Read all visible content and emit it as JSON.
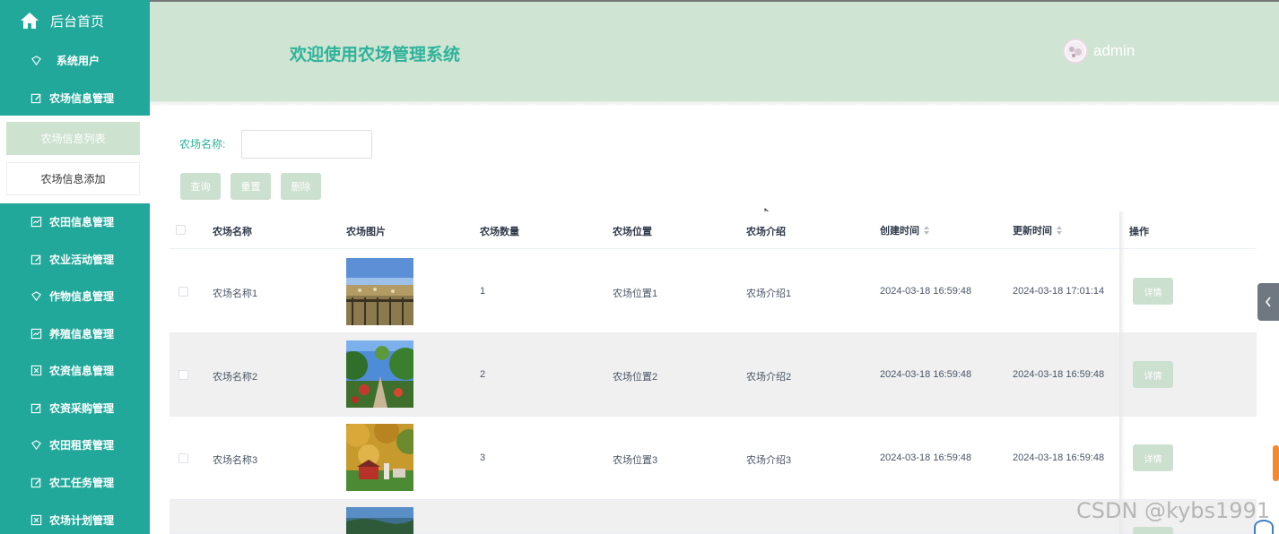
{
  "sidebar": {
    "home_label": "后台首页",
    "items_top": [
      {
        "label": "系统用户",
        "icon": "shield-icon"
      },
      {
        "label": "农场信息管理",
        "icon": "edit-icon"
      }
    ],
    "sub_items": [
      {
        "label": "农场信息列表",
        "active": true
      },
      {
        "label": "农场信息添加",
        "active": false
      }
    ],
    "items_bottom": [
      {
        "label": "农田信息管理",
        "icon": "chart-icon"
      },
      {
        "label": "农业活动管理",
        "icon": "edit-icon"
      },
      {
        "label": "作物信息管理",
        "icon": "shield-icon"
      },
      {
        "label": "养殖信息管理",
        "icon": "chart-icon"
      },
      {
        "label": "农资信息管理",
        "icon": "close-box-icon"
      },
      {
        "label": "农资采购管理",
        "icon": "edit-icon"
      },
      {
        "label": "农田租赁管理",
        "icon": "shield-icon"
      },
      {
        "label": "农工任务管理",
        "icon": "edit-icon"
      },
      {
        "label": "农场计划管理",
        "icon": "close-box-icon"
      }
    ]
  },
  "header": {
    "title": "欢迎使用农场管理系统",
    "username": "admin"
  },
  "search": {
    "label": "农场名称:",
    "value": "",
    "placeholder": ""
  },
  "buttons": {
    "query": "查询",
    "reset": "重置",
    "delete": "删除"
  },
  "table": {
    "columns": [
      "农场名称",
      "农场图片",
      "农场数量",
      "农场位置",
      "农场介绍",
      "创建时间",
      "更新时间",
      "操作"
    ],
    "rows": [
      {
        "name": "农场名称1",
        "quantity": "1",
        "location": "农场位置1",
        "intro": "农场介绍1",
        "created": "2024-03-18 16:59:48",
        "updated": "2024-03-18 17:01:14",
        "action": "详情"
      },
      {
        "name": "农场名称2",
        "quantity": "2",
        "location": "农场位置2",
        "intro": "农场介绍2",
        "created": "2024-03-18 16:59:48",
        "updated": "2024-03-18 16:59:48",
        "action": "详情"
      },
      {
        "name": "农场名称3",
        "quantity": "3",
        "location": "农场位置3",
        "intro": "农场介绍3",
        "created": "2024-03-18 16:59:48",
        "updated": "2024-03-18 16:59:48",
        "action": "详情"
      }
    ]
  },
  "watermark": "CSDN @kybs1991",
  "colors": {
    "sidebar": "#22a89b",
    "header": "#cfe4d2",
    "accent": "#2eb39b",
    "button": "#cce0cf"
  }
}
